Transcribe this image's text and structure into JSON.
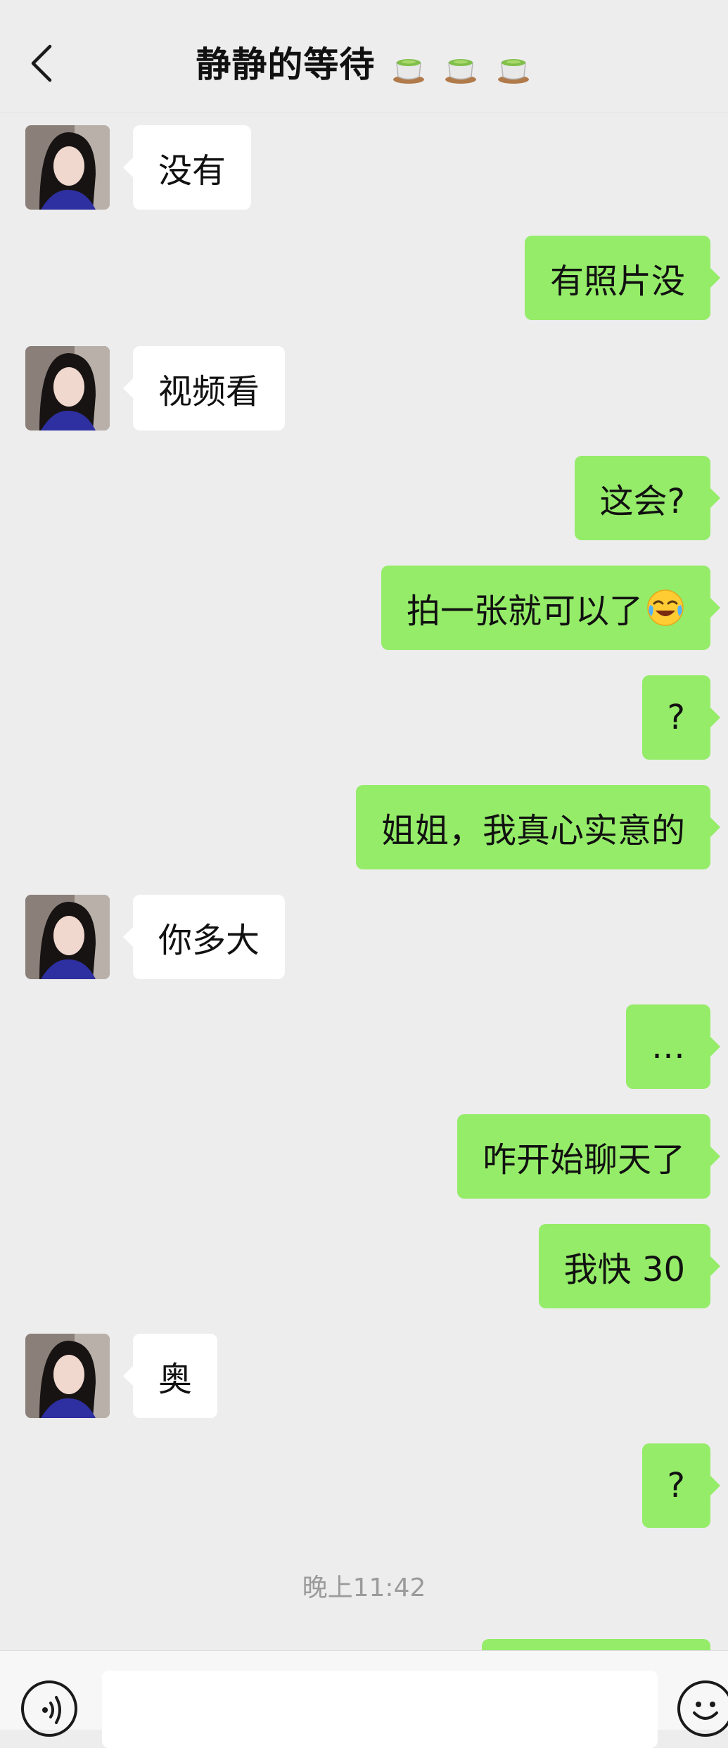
{
  "header": {
    "title": "静静的等待",
    "title_icon": "tea-cup-icon"
  },
  "messages": [
    {
      "side": "in",
      "text": "没有"
    },
    {
      "side": "out",
      "text": "有照片没"
    },
    {
      "side": "in",
      "text": "视频看"
    },
    {
      "side": "out",
      "text": "这会?"
    },
    {
      "side": "out",
      "text": "拍一张就可以了",
      "emoji": "crying-laughing-emoji"
    },
    {
      "side": "out",
      "text": "?"
    },
    {
      "side": "out",
      "text": "姐姐，我真心实意的"
    },
    {
      "side": "in",
      "text": "你多大"
    },
    {
      "side": "out",
      "text": "…"
    },
    {
      "side": "out",
      "text": "咋开始聊天了"
    },
    {
      "side": "out",
      "text": "我快 30"
    },
    {
      "side": "in",
      "text": "奥"
    },
    {
      "side": "out",
      "text": "?"
    }
  ],
  "timestamp": "晚上11:42",
  "colors": {
    "background": "#ededed",
    "outgoing_bubble": "#95ec69",
    "incoming_bubble": "#ffffff"
  },
  "bottom_bar": {
    "voice_icon": "voice-icon",
    "emoji_icon": "emoji-icon"
  }
}
